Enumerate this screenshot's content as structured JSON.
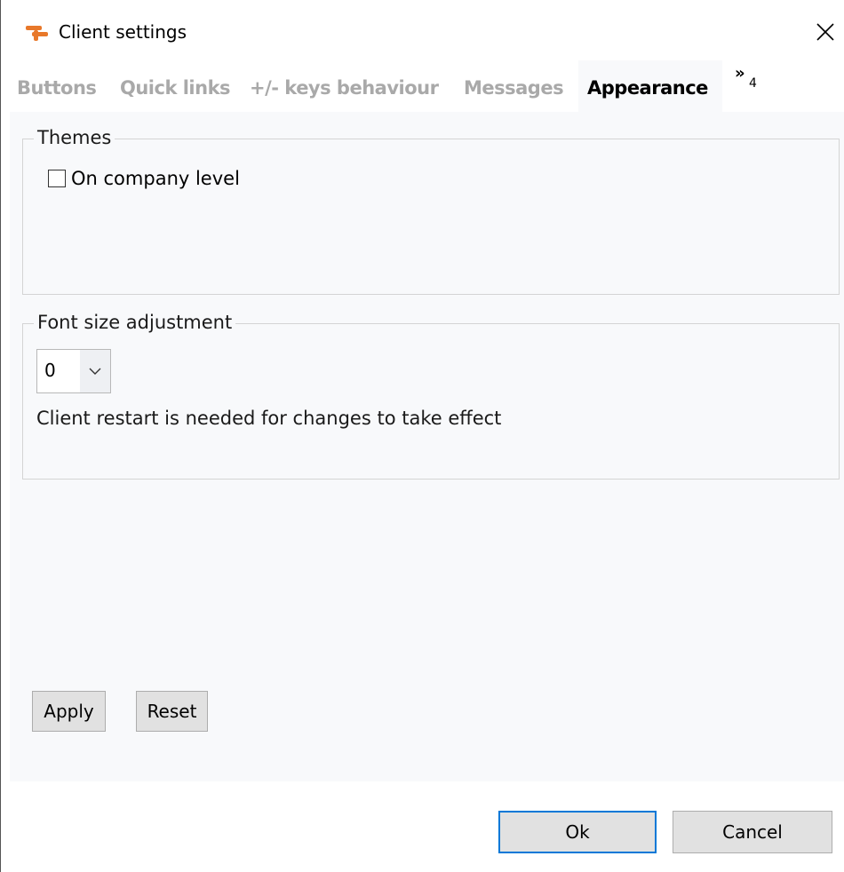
{
  "window": {
    "title": "Client settings",
    "app_icon": "app-logo-icon",
    "close_icon": "close-icon"
  },
  "tabs": [
    {
      "label": "Buttons",
      "active": false
    },
    {
      "label": "Quick links",
      "active": false
    },
    {
      "label": "+/- keys behaviour",
      "active": false
    },
    {
      "label": "Messages",
      "active": false
    },
    {
      "label": "Appearance",
      "active": true
    }
  ],
  "tab_overflow": {
    "chevron": "»",
    "count": "4"
  },
  "themes": {
    "legend": "Themes",
    "checkbox_label": "On company level",
    "checked": false
  },
  "font_size": {
    "legend": "Font size adjustment",
    "selected": "0",
    "note": "Client restart is needed for changes to take effect"
  },
  "actions": {
    "apply": "Apply",
    "reset": "Reset"
  },
  "footer": {
    "ok": "Ok",
    "cancel": "Cancel"
  },
  "colors": {
    "accent": "#0078d7",
    "icon_orange": "#e8782a",
    "content_bg": "#f8f9fb",
    "inactive_tab": "#a9a9a9"
  }
}
